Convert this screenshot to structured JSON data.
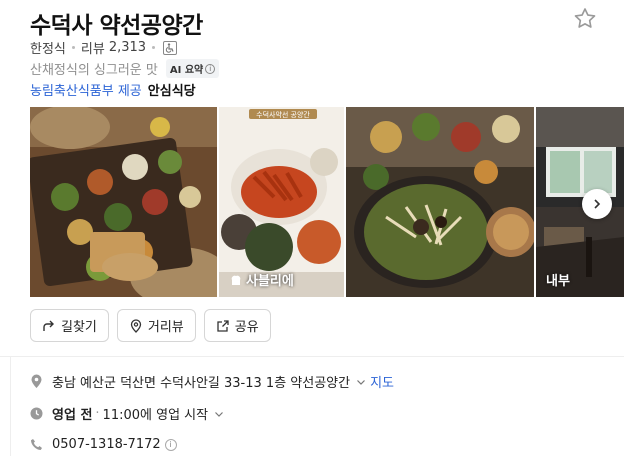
{
  "place": {
    "name": "수덕사 약선공양간",
    "category": "한정식",
    "review_label": "리뷰",
    "review_count": "2,313",
    "summary": "산채정식의 싱그러운 맛",
    "ai_badge": "AI 요약",
    "certification_link": "농림축산식품부 제공",
    "certification_badge": "안심식당"
  },
  "gallery": {
    "photos": [
      {
        "label": ""
      },
      {
        "label": "사블리에",
        "sign_text": "수덕사약선 공양간"
      },
      {
        "label": ""
      },
      {
        "label": "내부"
      }
    ]
  },
  "actions": {
    "directions": "길찾기",
    "street_view": "거리뷰",
    "share": "공유"
  },
  "details": {
    "address": "충남 예산군 덕산면 수덕사안길 33-13 1층 약선공양간",
    "map_link": "지도",
    "hours_status": "영업 전",
    "hours_text": "11:00에 영업 시작",
    "phone": "0507-1318-7172"
  },
  "colors": {
    "link": "#2c64d6",
    "muted": "#8f8f8f"
  }
}
